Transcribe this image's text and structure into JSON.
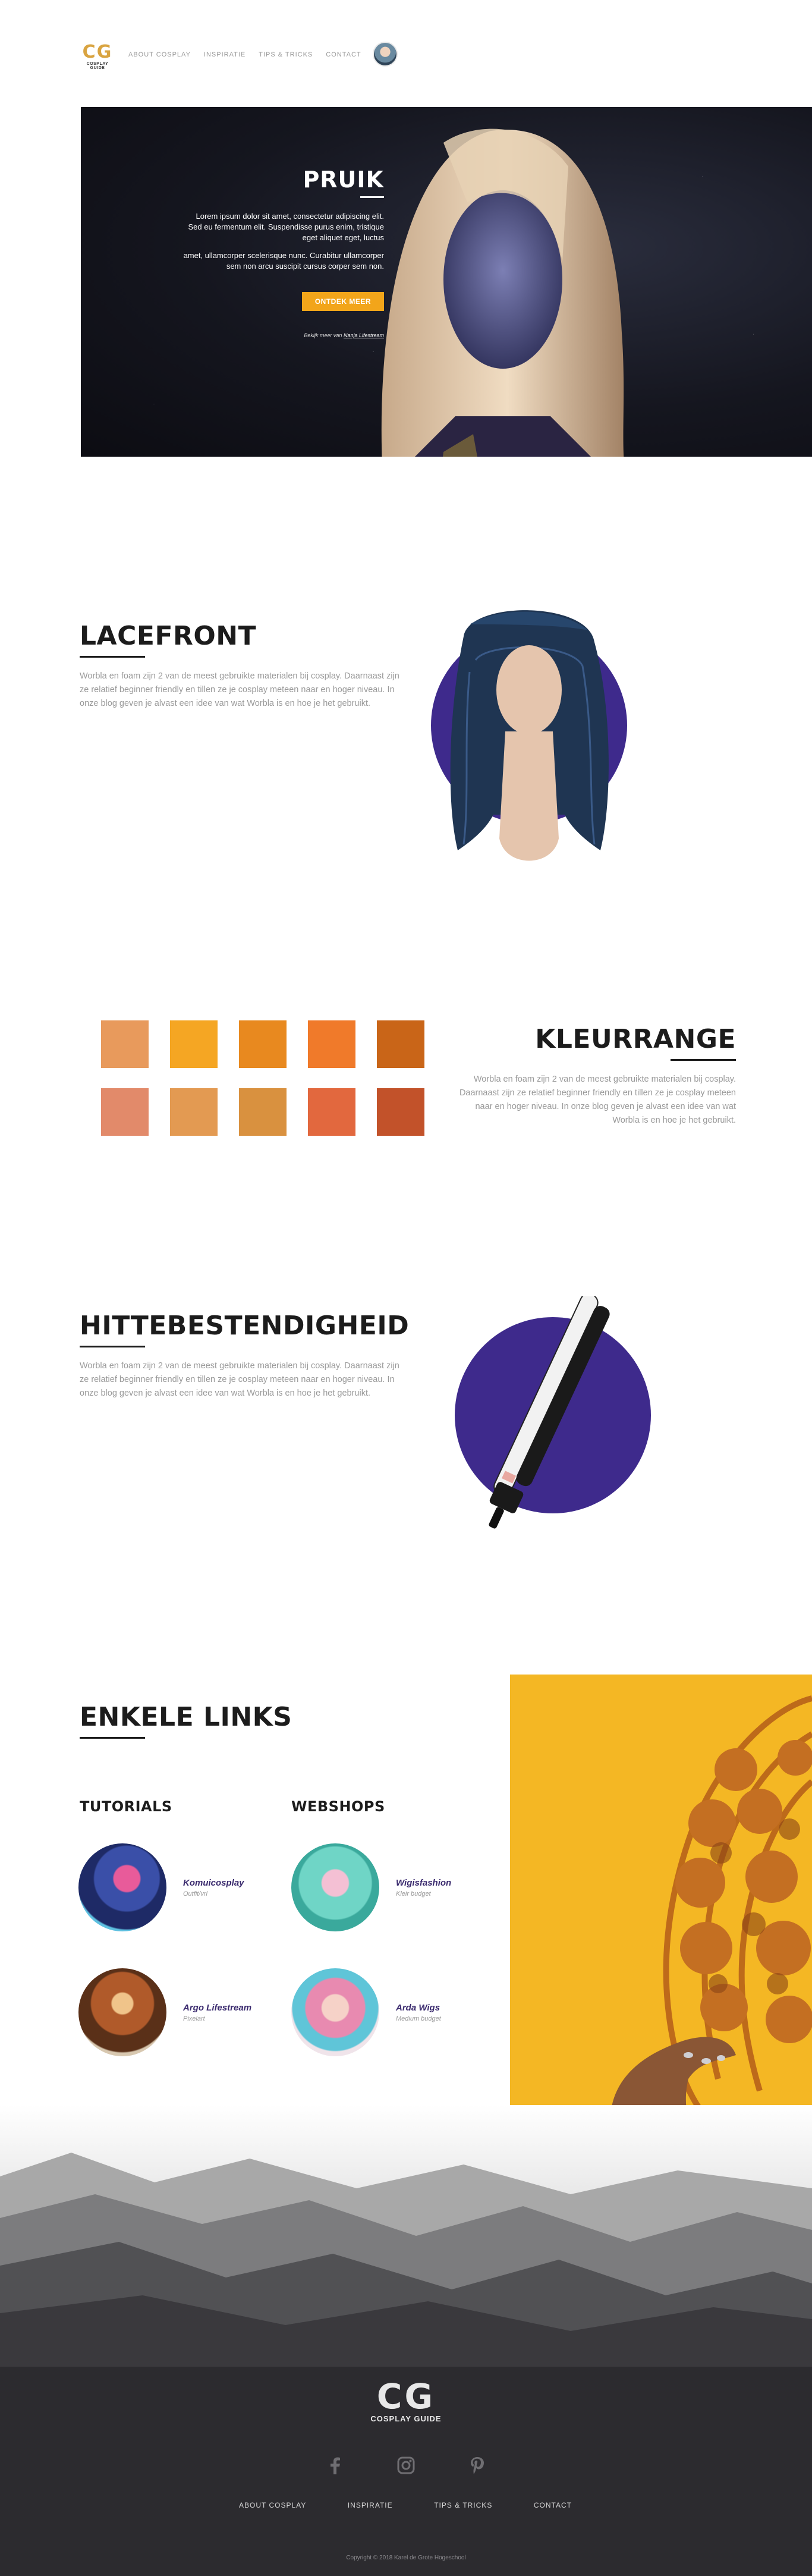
{
  "header": {
    "logo_mark": "CG",
    "logo_sub": "COSPLAY GUIDE",
    "nav": [
      "ABOUT COSPLAY",
      "INSPIRATIE",
      "TIPS & TRICKS",
      "CONTACT"
    ]
  },
  "hero": {
    "title": "PRUIK",
    "body1": "Lorem ipsum dolor sit amet, consectetur adipiscing elit. Sed eu fermentum elit. Suspendisse purus enim, tristique eget aliquet eget, luctus",
    "body2": "amet, ullamcorper scelerisque nunc. Curabitur ullamcorper sem non arcu suscipit cursus corper sem non.",
    "button": "ONTDEK MEER",
    "credit_prefix": "Bekijk meer van",
    "credit_link": "Nanja Lifestream"
  },
  "lacefront": {
    "title": "LACEFRONT",
    "body": "Worbla en foam zijn 2 van de meest gebruikte materialen bij cosplay. Daarnaast zijn ze relatief beginner friendly en tillen ze je cosplay meteen naar en hoger niveau. In onze blog geven je alvast een idee van wat Worbla is en hoe je het gebruikt."
  },
  "kleurrange": {
    "title": "KLEURRANGE",
    "body": "Worbla en foam zijn 2 van de meest gebruikte materialen bij cosplay. Daarnaast zijn ze relatief beginner friendly en tillen ze je cosplay meteen naar en hoger niveau. In onze blog geven je alvast een idee van wat Worbla is en hoe je het gebruikt.",
    "swatches": [
      "#e89a5c",
      "#f5a623",
      "#e8891f",
      "#f07a2a",
      "#c96518",
      "#e28a6a",
      "#e39a52",
      "#d9913f",
      "#e2683e",
      "#c2522a"
    ]
  },
  "hittebestendigheid": {
    "title": "HITTEBESTENDIGHEID",
    "body": "Worbla en foam zijn 2 van de meest gebruikte materialen bij cosplay. Daarnaast zijn ze relatief beginner friendly en tillen ze je cosplay meteen naar en hoger niveau. In onze blog geven je alvast een idee van wat Worbla is en hoe je het gebruikt."
  },
  "links": {
    "title": "ENKELE LINKS",
    "tutorials_title": "TUTORIALS",
    "webshops_title": "WEBSHOPS",
    "tutorials": [
      {
        "name": "Komuicosplay",
        "desc": "Outfit/vrl"
      },
      {
        "name": "Argo Lifestream",
        "desc": "Pixelart"
      }
    ],
    "webshops": [
      {
        "name": "Wigisfashion",
        "desc": "Kleir budget"
      },
      {
        "name": "Arda Wigs",
        "desc": "Medium budget"
      }
    ]
  },
  "footer": {
    "logo_mark": "CG",
    "logo_sub": "COSPLAY GUIDE",
    "social": [
      "facebook-icon",
      "instagram-icon",
      "pinterest-icon"
    ],
    "nav": [
      "ABOUT COSPLAY",
      "INSPIRATIE",
      "TIPS & TRICKS",
      "CONTACT"
    ],
    "copyright": "Copyright © 2018 Karel de Grote Hogeschool"
  },
  "colors": {
    "accent": "#f2a51a",
    "purple": "#3e2a8c",
    "footer_bg": "#2c2b2f",
    "yellow_panel": "#f4b724"
  }
}
